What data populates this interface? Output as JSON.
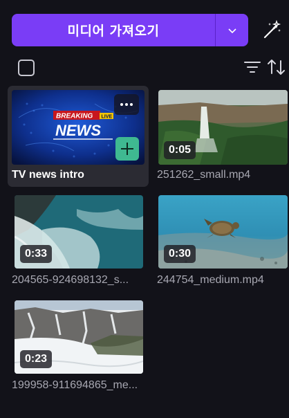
{
  "header": {
    "import_label": "미디어 가져오기",
    "accent": "#7a3df6"
  },
  "toolbar": {
    "select_all_icon": "checkbox-icon",
    "filter_icon": "filter-icon",
    "sort_icon": "sort-icon",
    "magic_icon": "magic-wand-icon"
  },
  "media": [
    {
      "name": "TV news intro",
      "duration": "",
      "thumb_text_1": "BREAKING",
      "thumb_text_2": "LIVE",
      "thumb_text_3": "NEWS",
      "selected": true
    },
    {
      "name": "251262_small.mp4",
      "duration": "0:05"
    },
    {
      "name": "204565-924698132_s...",
      "duration": "0:33"
    },
    {
      "name": "244754_medium.mp4",
      "duration": "0:30"
    },
    {
      "name": "199958-911694865_me...",
      "duration": "0:23"
    }
  ]
}
